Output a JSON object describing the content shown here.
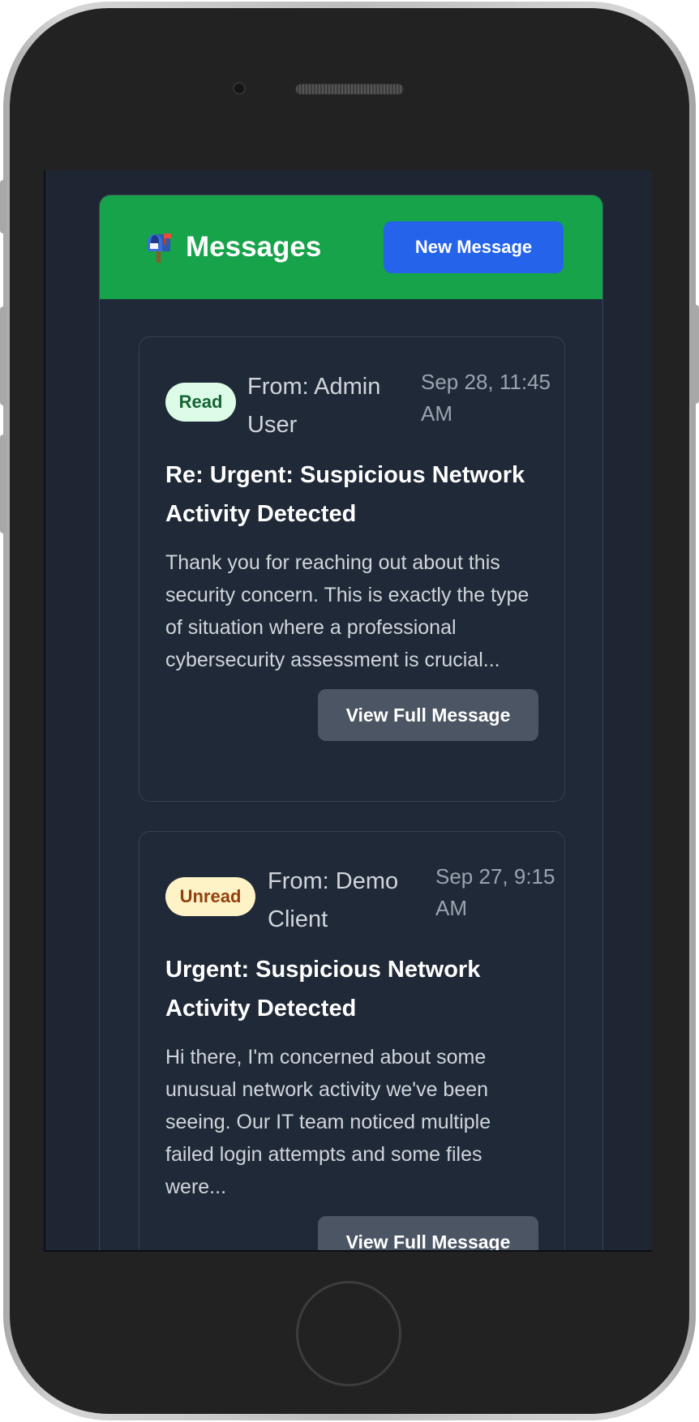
{
  "header": {
    "title": "Messages",
    "new_message_label": "New Message"
  },
  "messages": [
    {
      "status": "Read",
      "from": "From: Admin User",
      "date": "Sep 28, 11:45 AM",
      "subject": "Re: Urgent: Suspicious Network Activity Detected",
      "preview": "Thank you for reaching out about this security concern. This is exactly the type of situation where a professional cybersecurity assessment is crucial...",
      "view_label": "View Full Message"
    },
    {
      "status": "Unread",
      "from": "From: Demo Client",
      "date": "Sep 27, 9:15 AM",
      "subject": "Urgent: Suspicious Network Activity Detected",
      "preview": "Hi there, I'm concerned about some unusual network activity we've been seeing. Our IT team noticed multiple failed login attempts and some files were...",
      "view_label": "View Full Message"
    }
  ],
  "colors": {
    "header_bg": "#16a34a",
    "primary_button": "#2563eb",
    "secondary_button": "#4b5563",
    "screen_bg": "#1e2533",
    "read_badge_bg": "#dcfce7",
    "unread_badge_bg": "#fef3c7"
  },
  "icons": {
    "header": "mailbox-icon"
  }
}
